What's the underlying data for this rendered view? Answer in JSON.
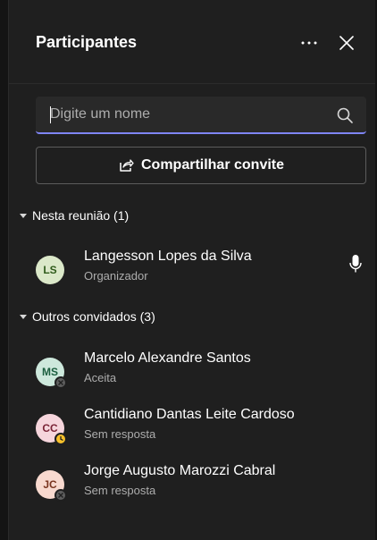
{
  "header": {
    "title": "Participantes",
    "more_icon": "more-horizontal-icon",
    "close_icon": "close-icon"
  },
  "search": {
    "placeholder": "Digite um nome",
    "value": "",
    "icon": "search-icon"
  },
  "share": {
    "label": "Compartilhar convite",
    "icon": "share-icon"
  },
  "sections": [
    {
      "label": "Nesta reunião (1)",
      "people": [
        {
          "initials": "LS",
          "name": "Langesson Lopes da Silva",
          "subtitle": "Organizador",
          "avatar_color": "#dbe8c9",
          "avatar_text_color": "#2f5a1b",
          "mic_icon": "microphone-icon"
        }
      ]
    },
    {
      "label": "Outros convidados (3)",
      "people": [
        {
          "initials": "MS",
          "name": "Marcelo Alexandre Santos",
          "subtitle": "Aceita",
          "avatar_color": "#cde8dc",
          "avatar_text_color": "#1b5e3f",
          "status_icon": "offline-status-icon"
        },
        {
          "initials": "CC",
          "name": "Cantidiano Dantas Leite Cardoso",
          "subtitle": "Sem resposta",
          "avatar_color": "#f6d5dc",
          "avatar_text_color": "#7a2336",
          "status_icon": "away-clock-status-icon"
        },
        {
          "initials": "JC",
          "name": "Jorge Augusto Marozzi Cabral",
          "subtitle": "Sem resposta",
          "avatar_color": "#f8d9cf",
          "avatar_text_color": "#7a3520",
          "status_icon": "offline-status-icon"
        }
      ]
    }
  ],
  "colors": {
    "background": "#1f1f1f",
    "accent": "#7f85f5",
    "away": "#f8c12b",
    "offline": "#8a8a8a"
  }
}
